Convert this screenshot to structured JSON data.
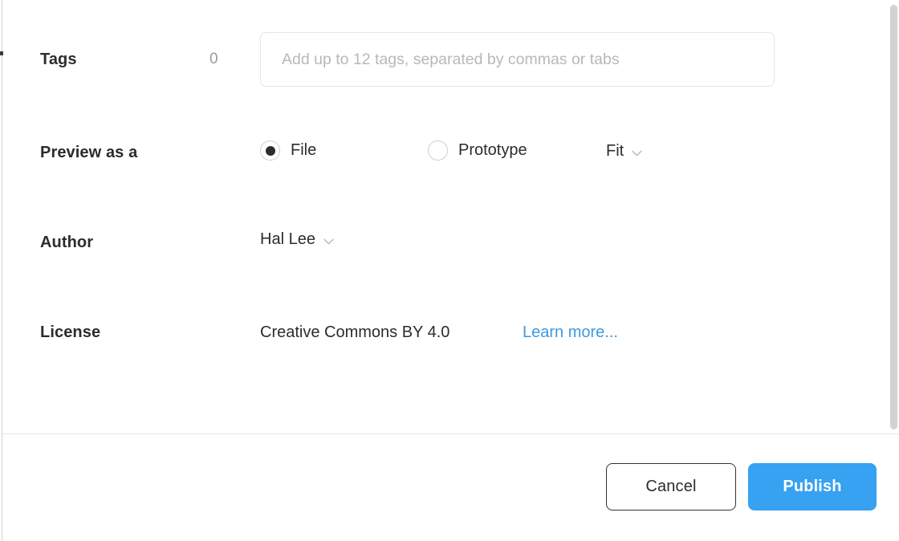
{
  "dialog": {
    "rows": [
      {
        "label": "Tags",
        "count": "0",
        "input_placeholder": "Add up to 12 tags, separated by commas or tabs",
        "input_value": ""
      },
      {
        "label": "Preview as a",
        "options": [
          {
            "label": "File",
            "selected": true
          },
          {
            "label": "Prototype",
            "selected": false
          }
        ],
        "fit_select": {
          "value": "Fit",
          "chevron": "chevron-down-icon"
        }
      },
      {
        "label": "Author",
        "author_select": {
          "value": "Hal Lee",
          "chevron": "chevron-down-icon"
        }
      },
      {
        "label": "License",
        "value": "Creative Commons BY 4.0",
        "link": "Learn more..."
      }
    ],
    "footer": {
      "cancel_label": "Cancel",
      "publish_label": "Publish"
    }
  },
  "colors": {
    "accent_blue": "#37a1f2",
    "link_blue": "#3b9ae0",
    "text_primary": "#2c2c2c",
    "text_muted": "#9a9a9a",
    "placeholder": "#b8b8b8",
    "border_light": "#e6e6e6",
    "border_strong": "#333333",
    "scrollbar": "#d2d2d2"
  }
}
